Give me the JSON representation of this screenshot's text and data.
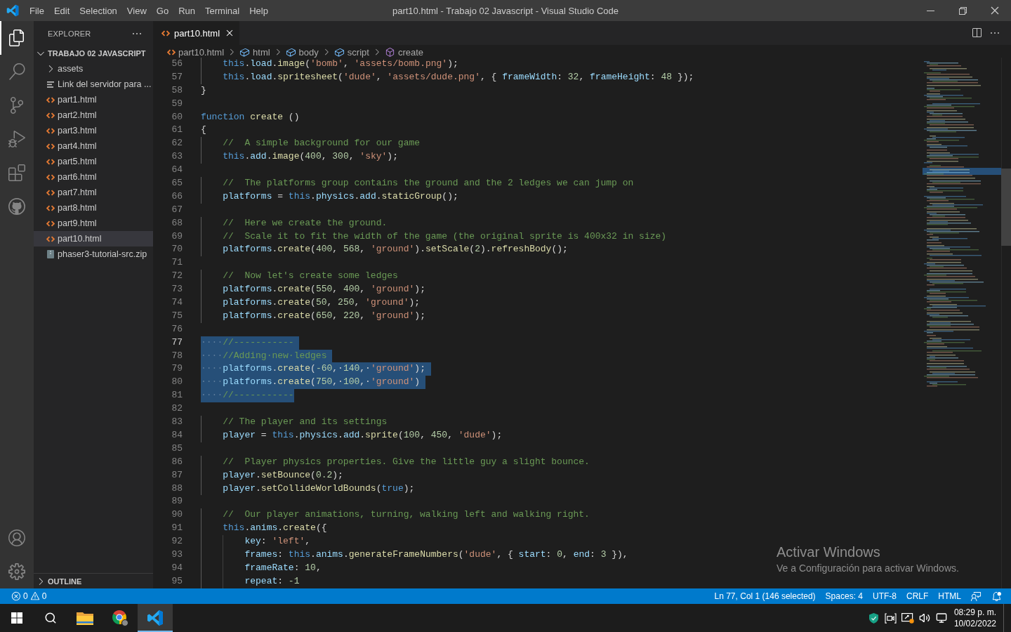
{
  "window": {
    "title": "part10.html - Trabajo 02 Javascript - Visual Studio Code"
  },
  "menu": [
    "File",
    "Edit",
    "Selection",
    "View",
    "Go",
    "Run",
    "Terminal",
    "Help"
  ],
  "activity_bar": {
    "items": [
      {
        "kind": "explorer",
        "selected": true
      },
      {
        "kind": "search",
        "selected": false
      },
      {
        "kind": "source-control",
        "selected": false
      },
      {
        "kind": "run-debug",
        "selected": false
      },
      {
        "kind": "extensions",
        "selected": false
      },
      {
        "kind": "github",
        "selected": false
      }
    ],
    "bottom_items": [
      {
        "kind": "account"
      },
      {
        "kind": "settings"
      }
    ]
  },
  "explorer": {
    "title": "EXPLORER",
    "workspace": {
      "label": "TRABAJO 02 JAVASCRIPT",
      "expanded": true,
      "children": [
        {
          "label": "assets",
          "kind": "folder",
          "expanded": false,
          "selected": false
        },
        {
          "label": "Link del servidor para ...",
          "kind": "text",
          "selected": false
        },
        {
          "label": "part1.html",
          "kind": "html",
          "selected": false
        },
        {
          "label": "part2.html",
          "kind": "html",
          "selected": false
        },
        {
          "label": "part3.html",
          "kind": "html",
          "selected": false
        },
        {
          "label": "part4.html",
          "kind": "html",
          "selected": false
        },
        {
          "label": "part5.html",
          "kind": "html",
          "selected": false
        },
        {
          "label": "part6.html",
          "kind": "html",
          "selected": false
        },
        {
          "label": "part7.html",
          "kind": "html",
          "selected": false
        },
        {
          "label": "part8.html",
          "kind": "html",
          "selected": false
        },
        {
          "label": "part9.html",
          "kind": "html",
          "selected": false
        },
        {
          "label": "part10.html",
          "kind": "html",
          "selected": true
        },
        {
          "label": "phaser3-tutorial-src.zip",
          "kind": "zip",
          "selected": false
        }
      ]
    },
    "outline": {
      "label": "OUTLINE",
      "expanded": false
    }
  },
  "editor": {
    "tabs": [
      {
        "label": "part10.html",
        "selected": true
      }
    ],
    "breadcrumbs": [
      {
        "label": "part10.html",
        "kind": "file"
      },
      {
        "label": "html",
        "kind": "element"
      },
      {
        "label": "body",
        "kind": "element"
      },
      {
        "label": "script",
        "kind": "element"
      },
      {
        "label": "create",
        "kind": "function"
      }
    ],
    "lines": [
      {
        "number": "56",
        "selected": false,
        "current": false,
        "tokens": [
          {
            "kind": "kw",
            "text": "    this"
          },
          {
            "kind": "punc",
            "text": "."
          },
          {
            "kind": "var",
            "text": "load"
          },
          {
            "kind": "punc",
            "text": "."
          },
          {
            "kind": "fn",
            "text": "image"
          },
          {
            "kind": "punc",
            "text": "("
          },
          {
            "kind": "str",
            "text": "'bomb'"
          },
          {
            "kind": "punc",
            "text": ", "
          },
          {
            "kind": "str",
            "text": "'assets/bomb.png'"
          },
          {
            "kind": "punc",
            "text": ");"
          }
        ]
      },
      {
        "number": "57",
        "selected": false,
        "current": false,
        "tokens": [
          {
            "kind": "kw",
            "text": "    this"
          },
          {
            "kind": "punc",
            "text": "."
          },
          {
            "kind": "var",
            "text": "load"
          },
          {
            "kind": "punc",
            "text": "."
          },
          {
            "kind": "fn",
            "text": "spritesheet"
          },
          {
            "kind": "punc",
            "text": "("
          },
          {
            "kind": "str",
            "text": "'dude'"
          },
          {
            "kind": "punc",
            "text": ", "
          },
          {
            "kind": "str",
            "text": "'assets/dude.png'"
          },
          {
            "kind": "punc",
            "text": ", { "
          },
          {
            "kind": "var",
            "text": "frameWidth"
          },
          {
            "kind": "punc",
            "text": ": "
          },
          {
            "kind": "num",
            "text": "32"
          },
          {
            "kind": "punc",
            "text": ", "
          },
          {
            "kind": "var",
            "text": "frameHeight"
          },
          {
            "kind": "punc",
            "text": ": "
          },
          {
            "kind": "num",
            "text": "48"
          },
          {
            "kind": "punc",
            "text": " });"
          }
        ]
      },
      {
        "number": "58",
        "selected": false,
        "current": false,
        "tokens": [
          {
            "kind": "punc",
            "text": "}"
          }
        ]
      },
      {
        "number": "59",
        "selected": false,
        "current": false
      },
      {
        "number": "60",
        "selected": false,
        "current": false,
        "tokens": [
          {
            "kind": "kw",
            "text": "function"
          },
          {
            "kind": "fn",
            "text": " create"
          },
          {
            "kind": "punc",
            "text": " ()"
          }
        ]
      },
      {
        "number": "61",
        "selected": false,
        "current": false,
        "tokens": [
          {
            "kind": "punc",
            "text": "{"
          }
        ]
      },
      {
        "number": "62",
        "selected": false,
        "current": false,
        "tokens": [
          {
            "kind": "com",
            "text": "    //  A simple background for our game"
          }
        ]
      },
      {
        "number": "63",
        "selected": false,
        "current": false,
        "tokens": [
          {
            "kind": "kw",
            "text": "    this"
          },
          {
            "kind": "punc",
            "text": "."
          },
          {
            "kind": "var",
            "text": "add"
          },
          {
            "kind": "punc",
            "text": "."
          },
          {
            "kind": "fn",
            "text": "image"
          },
          {
            "kind": "punc",
            "text": "("
          },
          {
            "kind": "num",
            "text": "400"
          },
          {
            "kind": "punc",
            "text": ", "
          },
          {
            "kind": "num",
            "text": "300"
          },
          {
            "kind": "punc",
            "text": ", "
          },
          {
            "kind": "str",
            "text": "'sky'"
          },
          {
            "kind": "punc",
            "text": ");"
          }
        ]
      },
      {
        "number": "64",
        "selected": false,
        "current": false
      },
      {
        "number": "65",
        "selected": false,
        "current": false,
        "tokens": [
          {
            "kind": "com",
            "text": "    //  The platforms group contains the ground and the 2 ledges we can jump on"
          }
        ]
      },
      {
        "number": "66",
        "selected": false,
        "current": false,
        "tokens": [
          {
            "kind": "var",
            "text": "    platforms"
          },
          {
            "kind": "punc",
            "text": " = "
          },
          {
            "kind": "kw",
            "text": "this"
          },
          {
            "kind": "punc",
            "text": "."
          },
          {
            "kind": "var",
            "text": "physics"
          },
          {
            "kind": "punc",
            "text": "."
          },
          {
            "kind": "var",
            "text": "add"
          },
          {
            "kind": "punc",
            "text": "."
          },
          {
            "kind": "fn",
            "text": "staticGroup"
          },
          {
            "kind": "punc",
            "text": "();"
          }
        ]
      },
      {
        "number": "67",
        "selected": false,
        "current": false
      },
      {
        "number": "68",
        "selected": false,
        "current": false,
        "tokens": [
          {
            "kind": "com",
            "text": "    //  Here we create the ground."
          }
        ]
      },
      {
        "number": "69",
        "selected": false,
        "current": false,
        "tokens": [
          {
            "kind": "com",
            "text": "    //  Scale it to fit the width of the game (the original sprite is 400x32 in size)"
          }
        ]
      },
      {
        "number": "70",
        "selected": false,
        "current": false,
        "tokens": [
          {
            "kind": "var",
            "text": "    platforms"
          },
          {
            "kind": "punc",
            "text": "."
          },
          {
            "kind": "fn",
            "text": "create"
          },
          {
            "kind": "punc",
            "text": "("
          },
          {
            "kind": "num",
            "text": "400"
          },
          {
            "kind": "punc",
            "text": ", "
          },
          {
            "kind": "num",
            "text": "568"
          },
          {
            "kind": "punc",
            "text": ", "
          },
          {
            "kind": "str",
            "text": "'ground'"
          },
          {
            "kind": "punc",
            "text": ")."
          },
          {
            "kind": "fn",
            "text": "setScale"
          },
          {
            "kind": "punc",
            "text": "("
          },
          {
            "kind": "num",
            "text": "2"
          },
          {
            "kind": "punc",
            "text": ")."
          },
          {
            "kind": "fn",
            "text": "refreshBody"
          },
          {
            "kind": "punc",
            "text": "();"
          }
        ]
      },
      {
        "number": "71",
        "selected": false,
        "current": false
      },
      {
        "number": "72",
        "selected": false,
        "current": false,
        "tokens": [
          {
            "kind": "com",
            "text": "    //  Now let's create some ledges"
          }
        ]
      },
      {
        "number": "73",
        "selected": false,
        "current": false,
        "tokens": [
          {
            "kind": "var",
            "text": "    platforms"
          },
          {
            "kind": "punc",
            "text": "."
          },
          {
            "kind": "fn",
            "text": "create"
          },
          {
            "kind": "punc",
            "text": "("
          },
          {
            "kind": "num",
            "text": "550"
          },
          {
            "kind": "punc",
            "text": ", "
          },
          {
            "kind": "num",
            "text": "400"
          },
          {
            "kind": "punc",
            "text": ", "
          },
          {
            "kind": "str",
            "text": "'ground'"
          },
          {
            "kind": "punc",
            "text": ");"
          }
        ]
      },
      {
        "number": "74",
        "selected": false,
        "current": false,
        "tokens": [
          {
            "kind": "var",
            "text": "    platforms"
          },
          {
            "kind": "punc",
            "text": "."
          },
          {
            "kind": "fn",
            "text": "create"
          },
          {
            "kind": "punc",
            "text": "("
          },
          {
            "kind": "num",
            "text": "50"
          },
          {
            "kind": "punc",
            "text": ", "
          },
          {
            "kind": "num",
            "text": "250"
          },
          {
            "kind": "punc",
            "text": ", "
          },
          {
            "kind": "str",
            "text": "'ground'"
          },
          {
            "kind": "punc",
            "text": ");"
          }
        ]
      },
      {
        "number": "75",
        "selected": false,
        "current": false,
        "tokens": [
          {
            "kind": "var",
            "text": "    platforms"
          },
          {
            "kind": "punc",
            "text": "."
          },
          {
            "kind": "fn",
            "text": "create"
          },
          {
            "kind": "punc",
            "text": "("
          },
          {
            "kind": "num",
            "text": "650"
          },
          {
            "kind": "punc",
            "text": ", "
          },
          {
            "kind": "num",
            "text": "220"
          },
          {
            "kind": "punc",
            "text": ", "
          },
          {
            "kind": "str",
            "text": "'ground'"
          },
          {
            "kind": "punc",
            "text": ");"
          }
        ]
      },
      {
        "number": "76",
        "selected": false,
        "current": false
      },
      {
        "number": "77",
        "selected": true,
        "current": true,
        "tokens": [
          {
            "kind": "com",
            "text": "····//-----------"
          }
        ]
      },
      {
        "number": "78",
        "selected": true,
        "current": false,
        "tokens": [
          {
            "kind": "com",
            "text": "····//Adding·new·ledges"
          }
        ]
      },
      {
        "number": "79",
        "selected": true,
        "current": false,
        "tokens": [
          {
            "kind": "var",
            "text": "····platforms"
          },
          {
            "kind": "punc",
            "text": "."
          },
          {
            "kind": "fn",
            "text": "create"
          },
          {
            "kind": "punc",
            "text": "("
          },
          {
            "kind": "num",
            "text": "-60"
          },
          {
            "kind": "punc",
            "text": ",·"
          },
          {
            "kind": "num",
            "text": "140"
          },
          {
            "kind": "punc",
            "text": ",·"
          },
          {
            "kind": "str",
            "text": "'ground'"
          },
          {
            "kind": "punc",
            "text": ");"
          }
        ]
      },
      {
        "number": "80",
        "selected": true,
        "current": false,
        "tokens": [
          {
            "kind": "var",
            "text": "····platforms"
          },
          {
            "kind": "punc",
            "text": "."
          },
          {
            "kind": "fn",
            "text": "create"
          },
          {
            "kind": "punc",
            "text": "("
          },
          {
            "kind": "num",
            "text": "750"
          },
          {
            "kind": "punc",
            "text": ",·"
          },
          {
            "kind": "num",
            "text": "100"
          },
          {
            "kind": "punc",
            "text": ",·"
          },
          {
            "kind": "str",
            "text": "'ground'"
          },
          {
            "kind": "punc",
            "text": ")"
          }
        ]
      },
      {
        "number": "81",
        "selected": true,
        "current": false,
        "tokens": [
          {
            "kind": "com",
            "text": "····//-----------"
          }
        ]
      },
      {
        "number": "82",
        "selected": false,
        "current": false
      },
      {
        "number": "83",
        "selected": false,
        "current": false,
        "tokens": [
          {
            "kind": "com",
            "text": "    // The player and its settings"
          }
        ]
      },
      {
        "number": "84",
        "selected": false,
        "current": false,
        "tokens": [
          {
            "kind": "var",
            "text": "    player"
          },
          {
            "kind": "punc",
            "text": " = "
          },
          {
            "kind": "kw",
            "text": "this"
          },
          {
            "kind": "punc",
            "text": "."
          },
          {
            "kind": "var",
            "text": "physics"
          },
          {
            "kind": "punc",
            "text": "."
          },
          {
            "kind": "var",
            "text": "add"
          },
          {
            "kind": "punc",
            "text": "."
          },
          {
            "kind": "fn",
            "text": "sprite"
          },
          {
            "kind": "punc",
            "text": "("
          },
          {
            "kind": "num",
            "text": "100"
          },
          {
            "kind": "punc",
            "text": ", "
          },
          {
            "kind": "num",
            "text": "450"
          },
          {
            "kind": "punc",
            "text": ", "
          },
          {
            "kind": "str",
            "text": "'dude'"
          },
          {
            "kind": "punc",
            "text": ");"
          }
        ]
      },
      {
        "number": "85",
        "selected": false,
        "current": false
      },
      {
        "number": "86",
        "selected": false,
        "current": false,
        "tokens": [
          {
            "kind": "com",
            "text": "    //  Player physics properties. Give the little guy a slight bounce."
          }
        ]
      },
      {
        "number": "87",
        "selected": false,
        "current": false,
        "tokens": [
          {
            "kind": "var",
            "text": "    player"
          },
          {
            "kind": "punc",
            "text": "."
          },
          {
            "kind": "fn",
            "text": "setBounce"
          },
          {
            "kind": "punc",
            "text": "("
          },
          {
            "kind": "num",
            "text": "0.2"
          },
          {
            "kind": "punc",
            "text": ");"
          }
        ]
      },
      {
        "number": "88",
        "selected": false,
        "current": false,
        "tokens": [
          {
            "kind": "var",
            "text": "    player"
          },
          {
            "kind": "punc",
            "text": "."
          },
          {
            "kind": "fn",
            "text": "setCollideWorldBounds"
          },
          {
            "kind": "punc",
            "text": "("
          },
          {
            "kind": "kw",
            "text": "true"
          },
          {
            "kind": "punc",
            "text": ");"
          }
        ]
      },
      {
        "number": "89",
        "selected": false,
        "current": false
      },
      {
        "number": "90",
        "selected": false,
        "current": false,
        "tokens": [
          {
            "kind": "com",
            "text": "    //  Our player animations, turning, walking left and walking right."
          }
        ]
      },
      {
        "number": "91",
        "selected": false,
        "current": false,
        "tokens": [
          {
            "kind": "kw",
            "text": "    this"
          },
          {
            "kind": "punc",
            "text": "."
          },
          {
            "kind": "var",
            "text": "anims"
          },
          {
            "kind": "punc",
            "text": "."
          },
          {
            "kind": "fn",
            "text": "create"
          },
          {
            "kind": "punc",
            "text": "({"
          }
        ]
      },
      {
        "number": "92",
        "selected": false,
        "current": false,
        "tokens": [
          {
            "kind": "var",
            "text": "        key"
          },
          {
            "kind": "punc",
            "text": ": "
          },
          {
            "kind": "str",
            "text": "'left'"
          },
          {
            "kind": "punc",
            "text": ","
          }
        ]
      },
      {
        "number": "93",
        "selected": false,
        "current": false,
        "tokens": [
          {
            "kind": "var",
            "text": "        frames"
          },
          {
            "kind": "punc",
            "text": ": "
          },
          {
            "kind": "kw",
            "text": "this"
          },
          {
            "kind": "punc",
            "text": "."
          },
          {
            "kind": "var",
            "text": "anims"
          },
          {
            "kind": "punc",
            "text": "."
          },
          {
            "kind": "fn",
            "text": "generateFrameNumbers"
          },
          {
            "kind": "punc",
            "text": "("
          },
          {
            "kind": "str",
            "text": "'dude'"
          },
          {
            "kind": "punc",
            "text": ", { "
          },
          {
            "kind": "var",
            "text": "start"
          },
          {
            "kind": "punc",
            "text": ": "
          },
          {
            "kind": "num",
            "text": "0"
          },
          {
            "kind": "punc",
            "text": ", "
          },
          {
            "kind": "var",
            "text": "end"
          },
          {
            "kind": "punc",
            "text": ": "
          },
          {
            "kind": "num",
            "text": "3"
          },
          {
            "kind": "punc",
            "text": " }),"
          }
        ]
      },
      {
        "number": "94",
        "selected": false,
        "current": false,
        "tokens": [
          {
            "kind": "var",
            "text": "        frameRate"
          },
          {
            "kind": "punc",
            "text": ": "
          },
          {
            "kind": "num",
            "text": "10"
          },
          {
            "kind": "punc",
            "text": ","
          }
        ]
      },
      {
        "number": "95",
        "selected": false,
        "current": false,
        "tokens": [
          {
            "kind": "var",
            "text": "        repeat"
          },
          {
            "kind": "punc",
            "text": ": "
          },
          {
            "kind": "num",
            "text": "-1"
          }
        ]
      }
    ]
  },
  "status_bar": {
    "problems": {
      "errors": "0",
      "warnings": "0"
    },
    "items": [
      "Ln 77, Col 1 (146 selected)",
      "Spaces: 4",
      "UTF-8",
      "CRLF",
      "HTML"
    ]
  },
  "taskbar": {
    "apps": [
      {
        "kind": "file-explorer",
        "selected": false
      },
      {
        "kind": "browser",
        "selected": false
      },
      {
        "kind": "code-editor",
        "selected": true
      }
    ],
    "clock": {
      "time": "08:29 p. m.",
      "date": "10/02/2022"
    }
  },
  "windows_activation": {
    "title": "Activar Windows",
    "text": "Ve a Configuración para activar Windows."
  }
}
